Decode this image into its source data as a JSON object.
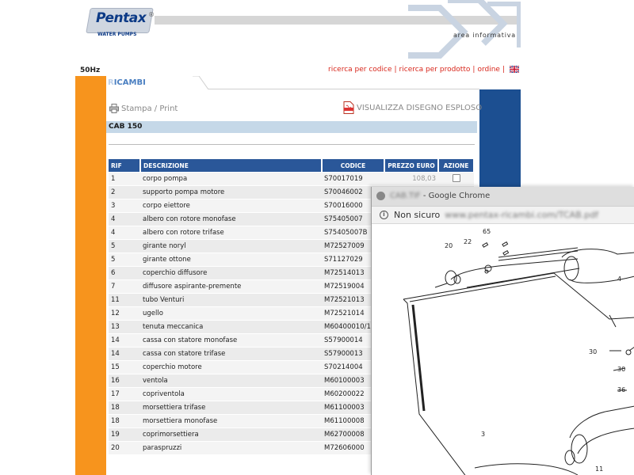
{
  "header": {
    "logo_text": "Pentax",
    "logo_sub": "WATER PUMPS",
    "logo_reg": "®",
    "area_info": "area informativa",
    "frequency": "50Hz",
    "nav": [
      "ricerca per codice",
      "ricerca per prodotto",
      "ordine"
    ],
    "nav_sep": "|",
    "flag_icon": "uk-flag-icon"
  },
  "section": {
    "tab_first_letter": "R",
    "tab_rest": "ICAMBI",
    "print_label": "Stampa / Print",
    "print_icon": "printer-icon",
    "explode_label": "VISUALIZZA DISEGNO ESPLOSO",
    "explode_icon": "pdf-icon",
    "title": "CAB 150"
  },
  "table": {
    "headers": [
      "RIF",
      "DESCRIZIONE",
      "CODICE",
      "PREZZO EURO",
      "AZIONE"
    ],
    "rows": [
      {
        "rif": "1",
        "desc": "corpo pompa",
        "code": "S70017019",
        "price": "108,03"
      },
      {
        "rif": "2",
        "desc": "supporto pompa motore",
        "code": "S70046002",
        "price": ""
      },
      {
        "rif": "3",
        "desc": "corpo eiettore",
        "code": "S70016000",
        "price": ""
      },
      {
        "rif": "4",
        "desc": "albero con rotore monofase",
        "code": "S75405007",
        "price": ""
      },
      {
        "rif": "4",
        "desc": "albero con rotore trifase",
        "code": "S75405007B",
        "price": ""
      },
      {
        "rif": "5",
        "desc": "girante noryl",
        "code": "M72527009",
        "price": ""
      },
      {
        "rif": "5",
        "desc": "girante ottone",
        "code": "S71127029",
        "price": ""
      },
      {
        "rif": "6",
        "desc": "coperchio diffusore",
        "code": "M72514013",
        "price": ""
      },
      {
        "rif": "7",
        "desc": "diffusore aspirante-premente",
        "code": "M72519004",
        "price": ""
      },
      {
        "rif": "11",
        "desc": "tubo Venturi",
        "code": "M72521013",
        "price": ""
      },
      {
        "rif": "12",
        "desc": "ugello",
        "code": "M72521014",
        "price": ""
      },
      {
        "rif": "13",
        "desc": "tenuta meccanica",
        "code": "M60400010/1",
        "price": ""
      },
      {
        "rif": "14",
        "desc": "cassa con statore monofase",
        "code": "S57900014",
        "price": ""
      },
      {
        "rif": "14",
        "desc": "cassa con statore trifase",
        "code": "S57900013",
        "price": ""
      },
      {
        "rif": "15",
        "desc": "coperchio motore",
        "code": "S70214004",
        "price": ""
      },
      {
        "rif": "16",
        "desc": "ventola",
        "code": "M60100003",
        "price": ""
      },
      {
        "rif": "17",
        "desc": "copriventola",
        "code": "M60200022",
        "price": ""
      },
      {
        "rif": "18",
        "desc": "morsettiera trifase",
        "code": "M61100003",
        "price": ""
      },
      {
        "rif": "18",
        "desc": "morsettiera monofase",
        "code": "M61100008",
        "price": ""
      },
      {
        "rif": "19",
        "desc": "coprimorsettiera",
        "code": "M62700008",
        "price": ""
      },
      {
        "rif": "20",
        "desc": "paraspruzzi",
        "code": "M72606000",
        "price": ""
      }
    ]
  },
  "chrome": {
    "title_blurred": "CAB.TIF",
    "title": "Google Chrome",
    "title_sep": " - ",
    "security": "Non sicuro",
    "url_blurred": "www.pentax-ricambi.com/TCAB.pdf",
    "drawing_labels": [
      "20",
      "22",
      "65",
      "4",
      "30",
      "30",
      "36",
      "3",
      "11"
    ]
  },
  "colors": {
    "orange": "#f7941d",
    "blue": "#1c4f91",
    "nav_red": "#d8271c",
    "table_header": "#2a5799",
    "title_bar": "#c5d8e8"
  }
}
